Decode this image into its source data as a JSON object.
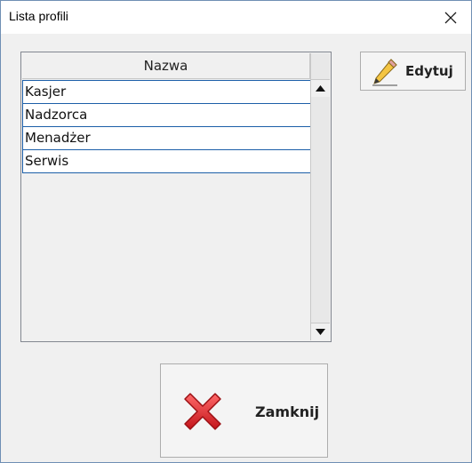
{
  "window": {
    "title": "Lista profili"
  },
  "list": {
    "column_header": "Nazwa",
    "items": [
      "Kasjer",
      "Nadzorca",
      "Menadżer",
      "Serwis"
    ]
  },
  "buttons": {
    "edit_label": "Edytuj",
    "close_label": "Zamknij"
  },
  "icons": {
    "window_close": "close-icon",
    "edit": "pencil-icon",
    "close_action": "red-x-icon",
    "scroll_up": "arrow-up-icon",
    "scroll_down": "arrow-down-icon"
  },
  "colors": {
    "window_bg": "#f0f0f0",
    "row_border": "#1c5fa8",
    "close_icon_red": "#e8262b"
  }
}
